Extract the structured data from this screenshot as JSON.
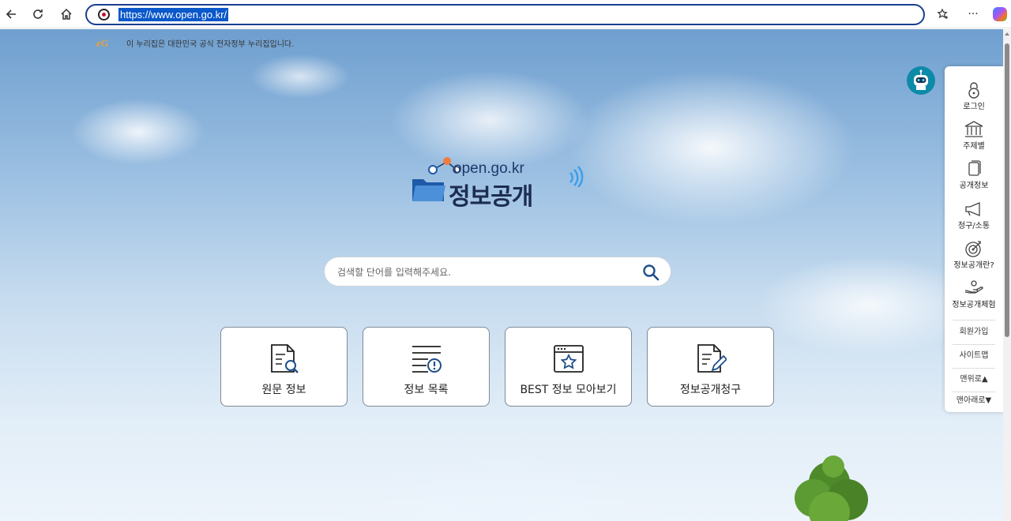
{
  "browser": {
    "url": "https://www.open.go.kr/"
  },
  "banner": {
    "text": "이 누리집은 대한민국 공식 전자정부 누리집입니다.",
    "logo_text": "eG"
  },
  "logo": {
    "domain": "open.go.kr",
    "title": "정보공개"
  },
  "search": {
    "placeholder": "검색할 단어를 입력해주세요."
  },
  "cards": [
    {
      "label": "원문 정보",
      "icon": "document-search-icon"
    },
    {
      "label": "정보 목록",
      "icon": "list-alert-icon"
    },
    {
      "label": "BEST 정보 모아보기",
      "icon": "window-star-icon"
    },
    {
      "label": "정보공개청구",
      "icon": "document-edit-icon"
    }
  ],
  "quick_menu": {
    "items": [
      {
        "label": "로그인",
        "icon": "lock-icon"
      },
      {
        "label": "주제별",
        "icon": "building-icon"
      },
      {
        "label": "공개정보",
        "icon": "copy-icon"
      },
      {
        "label": "청구/소통",
        "icon": "megaphone-icon"
      },
      {
        "label": "정보공개란?",
        "icon": "target-icon"
      },
      {
        "label": "정보공개체험",
        "icon": "hand-icon"
      }
    ],
    "links": [
      "회원가입",
      "사이트맵",
      "맨위로▲",
      "맨아래로▼"
    ]
  },
  "colors": {
    "accent": "#1a3d8f",
    "brand_dark": "#1c2d52",
    "brand_blue": "#2f6db5",
    "chatbot": "#0d8aa8"
  }
}
